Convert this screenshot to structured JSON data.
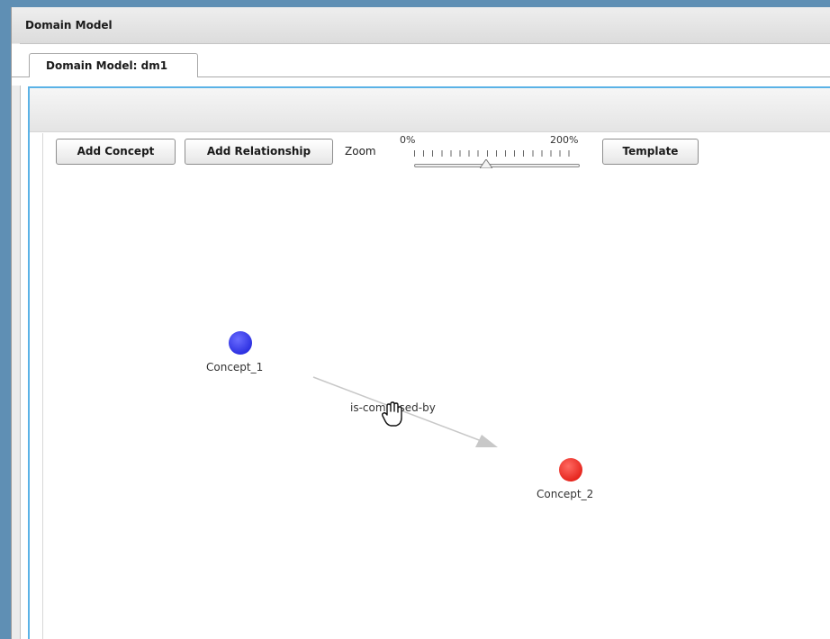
{
  "window": {
    "title": "Domain Model"
  },
  "tabs": [
    {
      "label": "Domain Model: dm1",
      "active": true
    }
  ],
  "toolbar": {
    "add_concept_label": "Add Concept",
    "add_relationship_label": "Add Relationship",
    "zoom_label": "Zoom",
    "zoom_min_label": "0%",
    "zoom_max_label": "200%",
    "zoom_value_fraction": 0.44,
    "template_label": "Template"
  },
  "diagram": {
    "concepts": [
      {
        "id": "concept_1",
        "label": "Concept_1",
        "color": "#3a3ef0"
      },
      {
        "id": "concept_2",
        "label": "Concept_2",
        "color": "#f23a32"
      }
    ],
    "relationships": [
      {
        "label": "is-composed-by",
        "from": "concept_1",
        "to": "concept_2",
        "color": "#c8c8c8"
      }
    ]
  },
  "colors": {
    "accent_border": "#5ab2e6",
    "desktop_background": "#5f8fb4"
  },
  "icons": {
    "cursor": "hand-grab-icon"
  }
}
